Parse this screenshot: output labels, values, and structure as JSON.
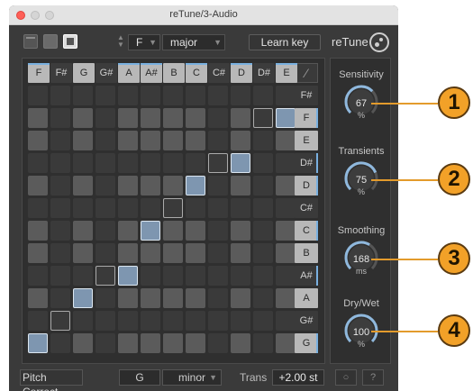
{
  "window": {
    "title": "reTune/3-Audio"
  },
  "toolbar": {
    "key": "F",
    "scale": "major",
    "learn_key": "Learn key",
    "brand": "reTune"
  },
  "grid": {
    "columns": [
      {
        "label": "F",
        "lit": true,
        "accent": true
      },
      {
        "label": "F#",
        "lit": false,
        "accent": false
      },
      {
        "label": "G",
        "lit": true,
        "accent": false
      },
      {
        "label": "G#",
        "lit": false,
        "accent": false
      },
      {
        "label": "A",
        "lit": true,
        "accent": true
      },
      {
        "label": "A#",
        "lit": true,
        "accent": true
      },
      {
        "label": "B",
        "lit": true,
        "accent": false
      },
      {
        "label": "C",
        "lit": true,
        "accent": true
      },
      {
        "label": "C#",
        "lit": false,
        "accent": false
      },
      {
        "label": "D",
        "lit": true,
        "accent": true
      },
      {
        "label": "D#",
        "lit": false,
        "accent": false
      },
      {
        "label": "E",
        "lit": true,
        "accent": true
      }
    ],
    "rows": [
      {
        "label": "F#",
        "lit": false,
        "accent": false
      },
      {
        "label": "F",
        "lit": true,
        "accent": true
      },
      {
        "label": "E",
        "lit": true,
        "accent": false
      },
      {
        "label": "D#",
        "lit": false,
        "accent": true
      },
      {
        "label": "D",
        "lit": true,
        "accent": true
      },
      {
        "label": "C#",
        "lit": false,
        "accent": false
      },
      {
        "label": "C",
        "lit": true,
        "accent": true
      },
      {
        "label": "B",
        "lit": true,
        "accent": false
      },
      {
        "label": "A#",
        "lit": false,
        "accent": true
      },
      {
        "label": "A",
        "lit": true,
        "accent": false
      },
      {
        "label": "G#",
        "lit": false,
        "accent": false
      },
      {
        "label": "G",
        "lit": true,
        "accent": true
      }
    ],
    "active_cells": [
      {
        "row": 1,
        "col": 11
      },
      {
        "row": 3,
        "col": 9
      },
      {
        "row": 4,
        "col": 7
      },
      {
        "row": 6,
        "col": 5
      },
      {
        "row": 8,
        "col": 4
      },
      {
        "row": 9,
        "col": 2
      },
      {
        "row": 11,
        "col": 0
      }
    ],
    "outlined_cells": [
      {
        "row": 1,
        "col": 10
      },
      {
        "row": 3,
        "col": 8
      },
      {
        "row": 5,
        "col": 6
      },
      {
        "row": 8,
        "col": 3
      },
      {
        "row": 10,
        "col": 1
      }
    ]
  },
  "knobs": [
    {
      "label": "Sensitivity",
      "value": "67",
      "unit": "%",
      "fraction": 0.67
    },
    {
      "label": "Transients",
      "value": "75",
      "unit": "%",
      "fraction": 0.75
    },
    {
      "label": "Smoothing",
      "value": "168",
      "unit": "ms",
      "fraction": 0.62
    },
    {
      "label": "Dry/Wet",
      "value": "100",
      "unit": "%",
      "fraction": 1.0
    }
  ],
  "footer": {
    "pitch_correct": "Pitch Correct",
    "key": "G",
    "scale": "minor",
    "trans_label": "Trans",
    "trans_value": "+2.00 st",
    "help": "?"
  },
  "callouts": [
    "1",
    "2",
    "3",
    "4"
  ],
  "colors": {
    "accent": "#79b0e0",
    "callout": "#f2a128",
    "active_cell": "#7e96b0"
  }
}
